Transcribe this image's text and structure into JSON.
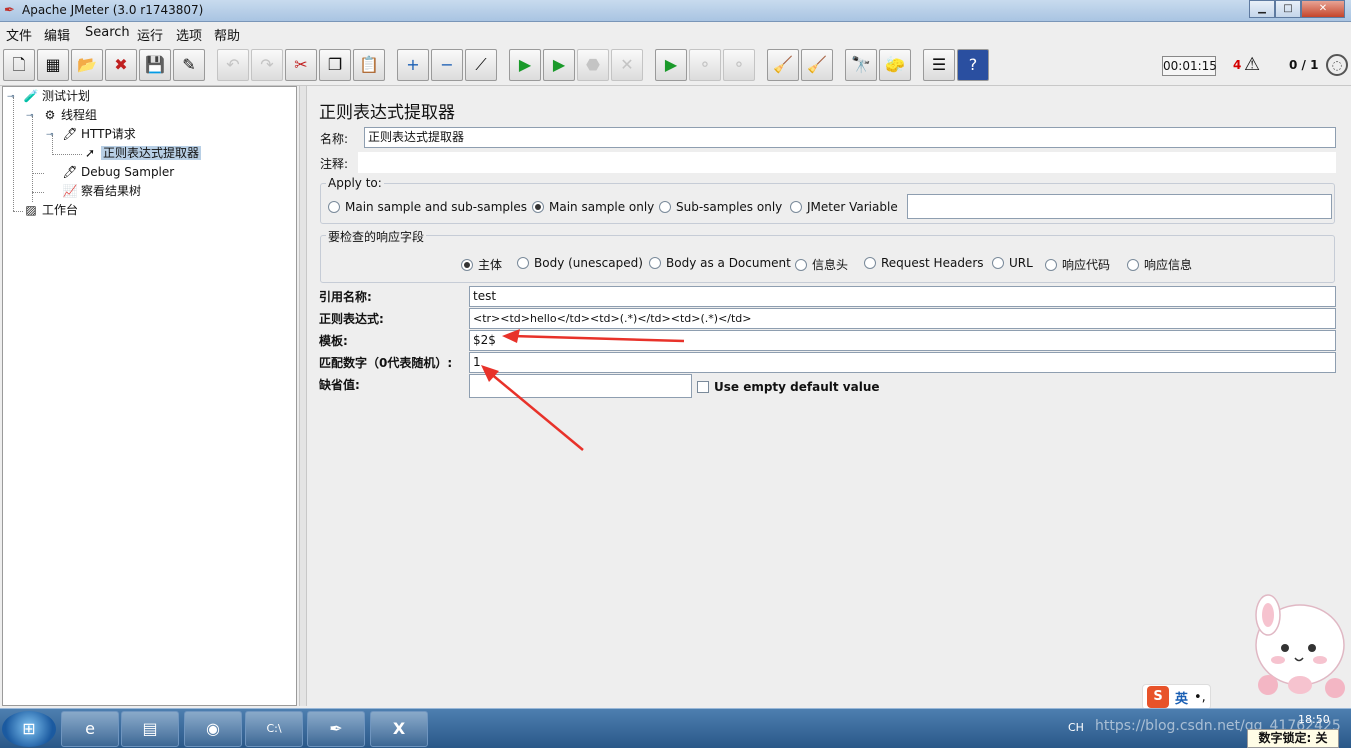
{
  "window": {
    "title": "Apache JMeter (3.0 r1743807)",
    "controls": {
      "minimize": "▁",
      "maximize": "□",
      "close": "✕"
    }
  },
  "menu": [
    "文件",
    "编辑",
    "Search",
    "运行",
    "选项",
    "帮助"
  ],
  "toolbar": {
    "buttons": [
      {
        "name": "new-icon",
        "glyph": "🗋"
      },
      {
        "name": "templates-icon",
        "glyph": "▦"
      },
      {
        "name": "open-icon",
        "glyph": "📂"
      },
      {
        "name": "close-icon",
        "glyph": "✖"
      },
      {
        "name": "save-icon",
        "glyph": "💾"
      },
      {
        "name": "save-as-icon",
        "glyph": "✎"
      },
      {
        "name": "undo-icon",
        "glyph": "↶"
      },
      {
        "name": "redo-icon",
        "glyph": "↷"
      },
      {
        "name": "cut-icon",
        "glyph": "✂"
      },
      {
        "name": "copy-icon",
        "glyph": "❐"
      },
      {
        "name": "paste-icon",
        "glyph": "📋"
      },
      {
        "name": "expand-icon",
        "glyph": "+"
      },
      {
        "name": "collapse-icon",
        "glyph": "−"
      },
      {
        "name": "toggle-icon",
        "glyph": "⟋"
      },
      {
        "name": "start-icon",
        "glyph": "▶"
      },
      {
        "name": "start-no-pause-icon",
        "glyph": "▶"
      },
      {
        "name": "stop-icon",
        "glyph": "⬣"
      },
      {
        "name": "shutdown-icon",
        "glyph": "✕"
      },
      {
        "name": "remote-start-icon",
        "glyph": "▶"
      },
      {
        "name": "remote-stop-icon",
        "glyph": "⚬"
      },
      {
        "name": "remote-shutdown-icon",
        "glyph": "⚬"
      },
      {
        "name": "clear-icon",
        "glyph": "🧹"
      },
      {
        "name": "clear-all-icon",
        "glyph": "🧹"
      },
      {
        "name": "search-icon",
        "glyph": "🔭"
      },
      {
        "name": "reset-search-icon",
        "glyph": "🧽"
      },
      {
        "name": "function-helper-icon",
        "glyph": "☰"
      },
      {
        "name": "help-icon",
        "glyph": "?"
      }
    ],
    "disabled": [
      "undo-icon",
      "redo-icon",
      "stop-icon",
      "shutdown-icon",
      "remote-stop-icon",
      "remote-shutdown-icon"
    ],
    "timer": "00:01:15",
    "error_count": "4",
    "warning_glyph": "⚠",
    "threads": "0 / 1"
  },
  "tree": {
    "nodes": [
      {
        "label": "测试计划",
        "icon": "🧪"
      },
      {
        "label": "线程组",
        "icon": "⚙"
      },
      {
        "label": "HTTP请求",
        "icon": "🖊"
      },
      {
        "label": "正则表达式提取器",
        "icon": "➚"
      },
      {
        "label": "Debug Sampler",
        "icon": "🖊"
      },
      {
        "label": "察看结果树",
        "icon": "📈"
      },
      {
        "label": "工作台",
        "icon": "▨"
      }
    ]
  },
  "form": {
    "title": "正则表达式提取器",
    "name_label": "名称:",
    "name_value": "正则表达式提取器",
    "comment_label": "注释:",
    "comment_value": "",
    "apply_to": {
      "title": "Apply to:",
      "options": [
        "Main sample and sub-samples",
        "Main sample only",
        "Sub-samples only",
        "JMeter Variable"
      ],
      "selected": "Main sample only",
      "variable_value": ""
    },
    "field_to_check": {
      "title": "要检查的响应字段",
      "options": [
        "主体",
        "Body (unescaped)",
        "Body as a Document",
        "信息头",
        "Request Headers",
        "URL",
        "响应代码",
        "响应信息"
      ],
      "selected": "主体"
    },
    "reference_name_label": "引用名称:",
    "reference_name_value": "test",
    "regex_label": "正则表达式:",
    "regex_value": "<tr><td>hello</td><td>(.*)</td><td>(.*)</td>",
    "template_label": "模板:",
    "template_value": "$2$",
    "match_no_label": "匹配数字（0代表随机）:",
    "match_no_value": "1",
    "default_label": "缺省值:",
    "default_value": "",
    "use_empty_default_label": "Use empty default value"
  },
  "annotation": {
    "arrow_color": "#e8322a"
  },
  "ime": {
    "english_label": "英"
  },
  "taskbar": {
    "apps": [
      {
        "name": "ie-icon",
        "glyph": "e"
      },
      {
        "name": "explorer-icon",
        "glyph": "▤"
      },
      {
        "name": "chrome-icon",
        "glyph": "◉"
      },
      {
        "name": "cmd-icon",
        "glyph": "C:\\"
      },
      {
        "name": "jmeter-icon",
        "glyph": "✒"
      },
      {
        "name": "xming-icon",
        "glyph": "X"
      }
    ],
    "lang": "CH",
    "clock": "18:50",
    "watermark": "https://blog.csdn.net/qq_41762425",
    "numlock": "数字锁定: 关"
  }
}
